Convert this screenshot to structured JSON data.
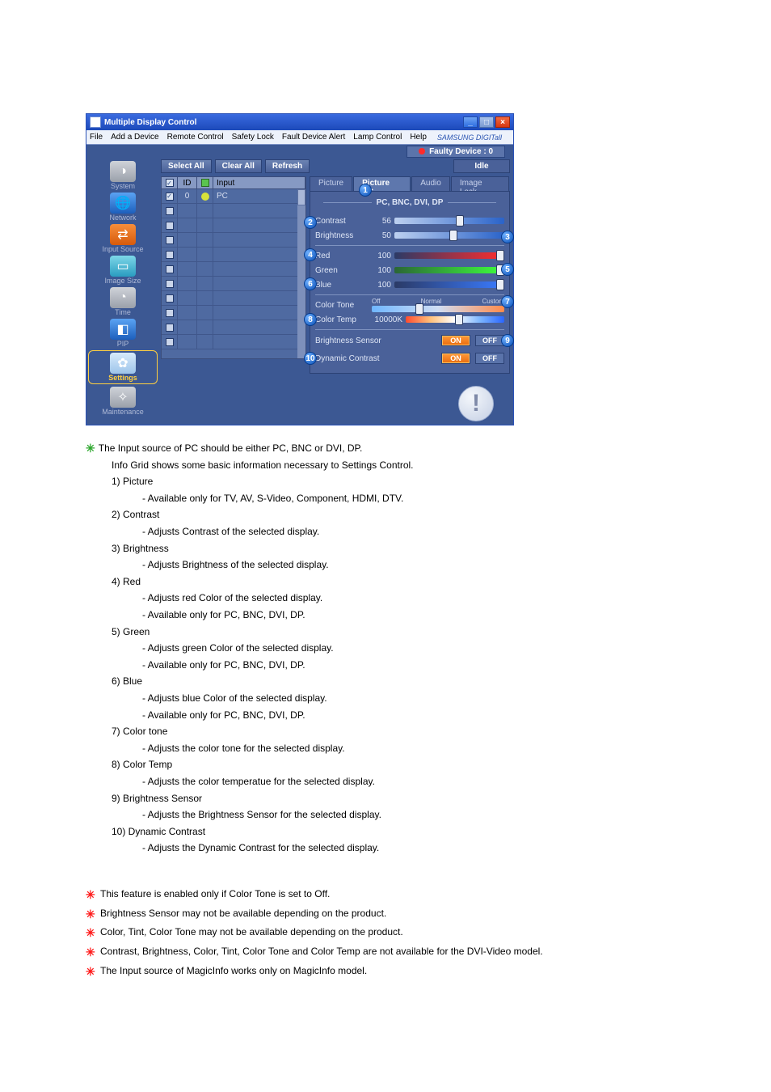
{
  "window": {
    "title": "Multiple Display Control",
    "menus": [
      "File",
      "Add a Device",
      "Remote Control",
      "Safety Lock",
      "Fault Device Alert",
      "Lamp Control",
      "Help"
    ],
    "brand": "SAMSUNG DIGITall",
    "faulty": "Faulty Device : 0"
  },
  "sidebar": [
    {
      "label": "System",
      "icon": "◑"
    },
    {
      "label": "Network",
      "icon": "🌐"
    },
    {
      "label": "Input Source",
      "icon": "⇄"
    },
    {
      "label": "Image Size",
      "icon": "▭"
    },
    {
      "label": "Time",
      "icon": "◔"
    },
    {
      "label": "PIP",
      "icon": "◧"
    },
    {
      "label": "Settings",
      "icon": "✿"
    },
    {
      "label": "Maintenance",
      "icon": "✧"
    }
  ],
  "toolbar": {
    "select_all": "Select All",
    "clear_all": "Clear All",
    "refresh": "Refresh",
    "idle": "Idle"
  },
  "grid": {
    "headers": {
      "id": "ID",
      "input": "Input"
    },
    "rows": [
      {
        "checked": true,
        "id": "0",
        "lamp": "green",
        "input": "PC"
      },
      {
        "checked": false,
        "id": "",
        "lamp": "",
        "input": ""
      },
      {
        "checked": false,
        "id": "",
        "lamp": "",
        "input": ""
      },
      {
        "checked": false,
        "id": "",
        "lamp": "",
        "input": ""
      },
      {
        "checked": false,
        "id": "",
        "lamp": "",
        "input": ""
      },
      {
        "checked": false,
        "id": "",
        "lamp": "",
        "input": ""
      },
      {
        "checked": false,
        "id": "",
        "lamp": "",
        "input": ""
      },
      {
        "checked": false,
        "id": "",
        "lamp": "",
        "input": ""
      },
      {
        "checked": false,
        "id": "",
        "lamp": "",
        "input": ""
      },
      {
        "checked": false,
        "id": "",
        "lamp": "",
        "input": ""
      },
      {
        "checked": false,
        "id": "",
        "lamp": "",
        "input": ""
      }
    ]
  },
  "tabs": [
    "Picture",
    "Picture PC",
    "Audio",
    "Image Lock"
  ],
  "active_tab": 1,
  "panel": {
    "source": "PC, BNC, DVI, DP",
    "contrast": {
      "label": "Contrast",
      "val": "56",
      "pct": 56
    },
    "brightness": {
      "label": "Brightness",
      "val": "50",
      "pct": 50
    },
    "red": {
      "label": "Red",
      "val": "100",
      "pct": 100
    },
    "green": {
      "label": "Green",
      "val": "100",
      "pct": 100
    },
    "blue": {
      "label": "Blue",
      "val": "100",
      "pct": 100
    },
    "color_tone": {
      "label": "Color Tone",
      "opts": [
        "Off",
        "Normal",
        "Custom"
      ],
      "pct": 33
    },
    "color_temp": {
      "label": "Color Temp",
      "val": "10000K",
      "pct": 50
    },
    "bright_sensor": {
      "label": "Brightness Sensor",
      "on": "ON",
      "off": "OFF"
    },
    "dyn_contrast": {
      "label": "Dynamic Contrast",
      "on": "ON",
      "off": "OFF"
    }
  },
  "callouts": [
    "1",
    "2",
    "3",
    "4",
    "5",
    "6",
    "7",
    "8",
    "9",
    "10"
  ],
  "explain": {
    "head": "The Input source of PC should be either PC, BNC or DVI, DP.",
    "items": [
      "Info Grid shows some basic information necessary to Settings Control.",
      "1)  Picture",
      "- Available only for TV, AV, S-Video, Component, HDMI, DTV.",
      "2)  Contrast",
      "- Adjusts Contrast of the selected display.",
      "3)  Brightness",
      "- Adjusts Brightness of the selected display.",
      "4)  Red",
      "- Adjusts red Color of the selected display.",
      "- Available only for PC, BNC, DVI, DP.",
      "5)  Green",
      "- Adjusts green Color of the selected display.",
      "- Available only for PC, BNC, DVI, DP.",
      "6)  Blue",
      "- Adjusts blue Color of the selected display.",
      "- Available only for PC, BNC, DVI, DP.",
      "7)  Color tone",
      "- Adjusts the color tone for the selected display.",
      "8)  Color Temp",
      "- Adjusts the color temperatue for the selected display.",
      "9)  Brightness Sensor",
      "- Adjusts the Brightness Sensor for the selected display.",
      "10)  Dynamic Contrast",
      "- Adjusts the Dynamic Contrast for the selected display."
    ],
    "notes": [
      "This feature is enabled only if Color Tone is set to Off.",
      "Brightness Sensor may not be available depending on the product.",
      "Color, Tint, Color Tone may not be available depending on the product.",
      "Contrast, Brightness, Color, Tint, Color Tone and Color Temp are not available for the DVI-Video model.",
      "The Input source of MagicInfo works only on MagicInfo model."
    ]
  }
}
